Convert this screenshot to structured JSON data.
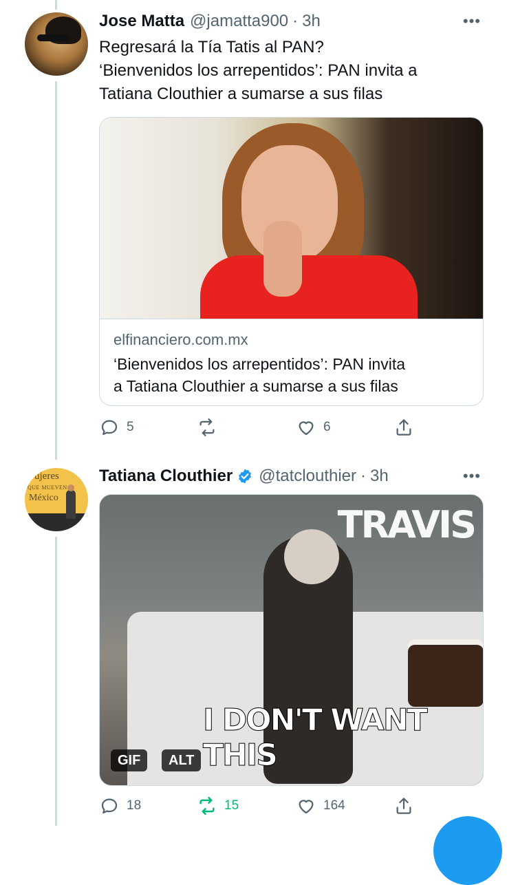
{
  "tweet1": {
    "name": "Jose Matta",
    "handle": "@jamatta900",
    "time": "3h",
    "text_lines": [
      "Regresará la Tía Tatis al PAN?",
      "‘Bienvenidos los arrepentidos’: PAN invita a",
      "Tatiana Clouthier a sumarse a sus filas"
    ],
    "card": {
      "domain": "elfinanciero.com.mx",
      "title_lines": [
        "‘Bienvenidos los arrepentidos’: PAN invita",
        "a Tatiana Clouthier a sumarse a sus filas"
      ]
    },
    "actions": {
      "replies": "5",
      "retweets": "",
      "likes": "6"
    }
  },
  "tweet2": {
    "name": "Tatiana Clouthier",
    "handle": "@tatclouthier",
    "time": "3h",
    "avatar_text": [
      "ujeres",
      "QUE MUEVEN A",
      "México"
    ],
    "media": {
      "brand": "TRAVIS",
      "caption": "I DON'T WANT THIS",
      "gif_badge": "GIF",
      "alt_badge": "ALT"
    },
    "actions": {
      "replies": "18",
      "retweets": "15",
      "likes": "164"
    }
  },
  "separator_dot": "·",
  "more_glyph": "•••",
  "colors": {
    "text": "#0f1419",
    "muted": "#536471",
    "retweet_active": "#00ba7c",
    "verified": "#1d9bf0",
    "border": "#cfd9de"
  }
}
